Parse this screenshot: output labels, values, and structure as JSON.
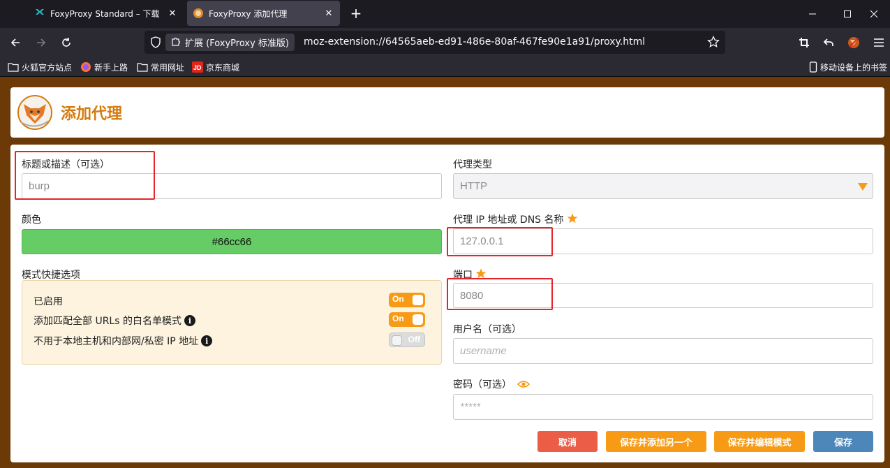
{
  "browser": {
    "tabs": [
      {
        "title": "FoxyProxy Standard – 下载 ",
        "active": false
      },
      {
        "title": "FoxyProxy 添加代理",
        "active": true
      }
    ],
    "url_chip": "扩展 (FoxyProxy 标准版)",
    "url": "moz-extension://64565aeb-ed91-486e-80af-467fe90e1a91/proxy.html",
    "bookmarks": [
      "火狐官方站点",
      "新手上路",
      "常用网址",
      "京东商城"
    ],
    "mobile_bookmarks": "移动设备上的书签"
  },
  "page": {
    "title": "添加代理",
    "brand_color": "#d57a0c",
    "background_color": "#6b3a07"
  },
  "form": {
    "title_label": "标题或描述（可选）",
    "title_value": "burp",
    "color_label": "颜色",
    "color_value": "#66cc66",
    "modes_label": "模式快捷选项",
    "modes": [
      {
        "label": "已启用",
        "toggle": "On",
        "info": false
      },
      {
        "label": "添加匹配全部 URLs 的白名单模式",
        "toggle": "On",
        "info": true
      },
      {
        "label": "不用于本地主机和内部网/私密 IP 地址",
        "toggle": "Off",
        "info": true
      }
    ],
    "type_label": "代理类型",
    "type_value": "HTTP",
    "host_label": "代理 IP 地址或 DNS 名称",
    "host_value": "127.0.0.1",
    "port_label": "端口",
    "port_value": "8080",
    "username_label": "用户名（可选）",
    "username_placeholder": "username",
    "password_label": "密码（可选）",
    "password_placeholder": "*****"
  },
  "buttons": {
    "cancel": "取消",
    "save_add": "保存并添加另一个",
    "save_edit": "保存并编辑模式",
    "save": "保存"
  },
  "highlight_color": "#e8232b"
}
